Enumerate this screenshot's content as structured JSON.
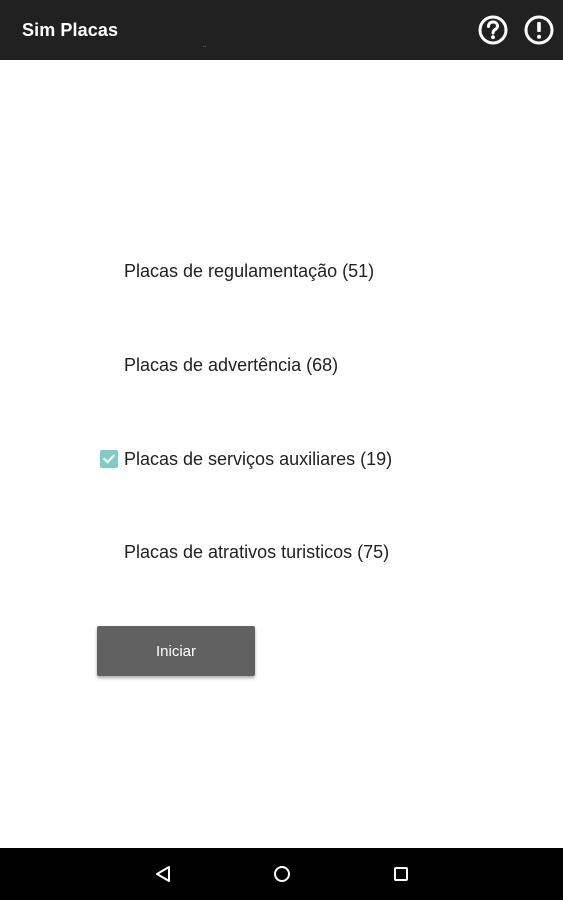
{
  "app_bar": {
    "title": "Sim Placas",
    "subtitle_dot": "..",
    "actions": [
      {
        "icon": "help-circle-icon"
      },
      {
        "icon": "alert-circle-icon"
      }
    ]
  },
  "options": [
    {
      "label": "Placas de regulamentação (51)",
      "checked": false
    },
    {
      "label": "Placas de advertência (68)",
      "checked": false
    },
    {
      "label": "Placas de serviços auxiliares (19)",
      "checked": true
    },
    {
      "label": "Placas de atrativos turisticos (75)",
      "checked": false
    }
  ],
  "start_button": {
    "label": "Iniciar"
  },
  "navigation_bar": {
    "buttons": [
      {
        "icon": "back-triangle-icon"
      },
      {
        "icon": "home-circle-icon"
      },
      {
        "icon": "recents-square-icon"
      }
    ]
  },
  "colors": {
    "app_bar_bg": "#212121",
    "checkbox_checked": "#80cbc4",
    "button_bg": "#616161",
    "nav_bar_bg": "#000000"
  }
}
